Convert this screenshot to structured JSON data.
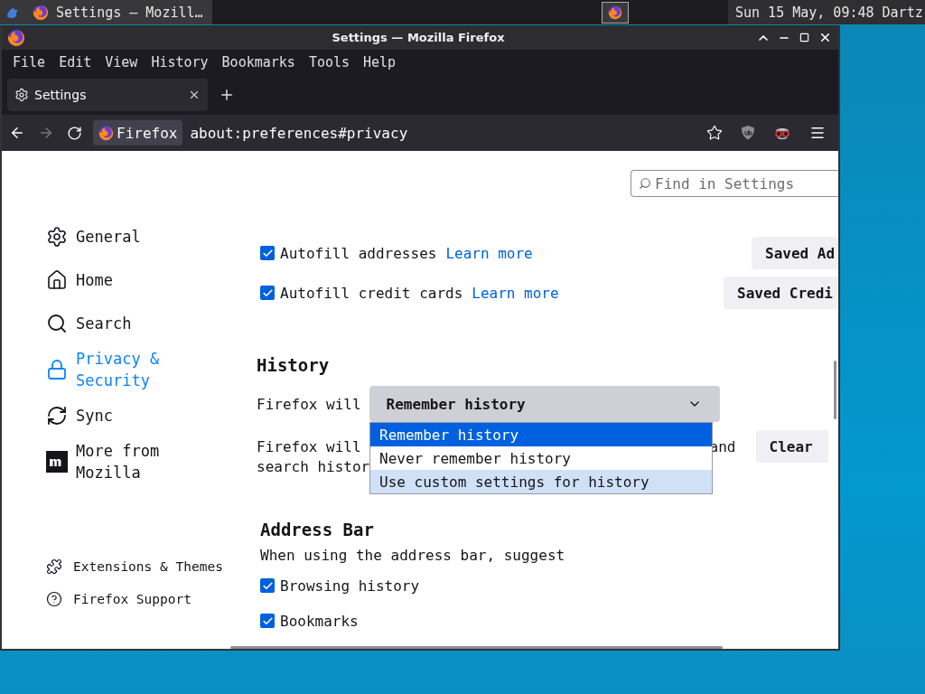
{
  "panel": {
    "task_title": "Settings — Mozill…",
    "clock": "Sun 15 May, 09:48 Dartz"
  },
  "window": {
    "title": "Settings — Mozilla Firefox"
  },
  "menu": [
    "File",
    "Edit",
    "View",
    "History",
    "Bookmarks",
    "Tools",
    "Help"
  ],
  "tabs": [
    {
      "label": "Settings",
      "selected": true
    }
  ],
  "address_bar": {
    "identity": "Firefox",
    "url": "about:preferences#privacy"
  },
  "search": {
    "placeholder": "Find in Settings"
  },
  "sidebar": {
    "items": [
      {
        "label": "General",
        "kind": "gear",
        "selected": false
      },
      {
        "label": "Home",
        "kind": "home",
        "selected": false
      },
      {
        "label": "Search",
        "kind": "search",
        "selected": false
      },
      {
        "label": "Privacy & Security",
        "kind": "lock",
        "selected": true
      },
      {
        "label": "Sync",
        "kind": "sync",
        "selected": false
      },
      {
        "label": "More from Mozilla",
        "kind": "mozilla",
        "selected": false
      }
    ],
    "footer": [
      {
        "label": "Extensions & Themes",
        "kind": "puzzle"
      },
      {
        "label": "Firefox Support",
        "kind": "help"
      }
    ]
  },
  "autofill": [
    {
      "label": "Autofill addresses",
      "link": "Learn more",
      "checked": true,
      "button": "Saved Ad"
    },
    {
      "label": "Autofill credit cards",
      "link": "Learn more",
      "checked": true,
      "button": "Saved Credi"
    }
  ],
  "history": {
    "heading": "History",
    "label": "Firefox will",
    "dropdown": {
      "value": "Remember history",
      "expanded": true,
      "options": [
        {
          "label": "Remember history",
          "selected": true,
          "hovered": false
        },
        {
          "label": "Never remember history",
          "selected": false,
          "hovered": false
        },
        {
          "label": "Use custom settings for history",
          "selected": false,
          "hovered": true
        }
      ]
    },
    "description": [
      "Firefox will",
      "and",
      "search histor"
    ],
    "clear_button": "Clear"
  },
  "address_section": {
    "heading": "Address Bar",
    "prompt": "When using the address bar, suggest",
    "options": [
      {
        "label": "Browsing history",
        "checked": true
      },
      {
        "label": "Bookmarks",
        "checked": true
      }
    ]
  }
}
